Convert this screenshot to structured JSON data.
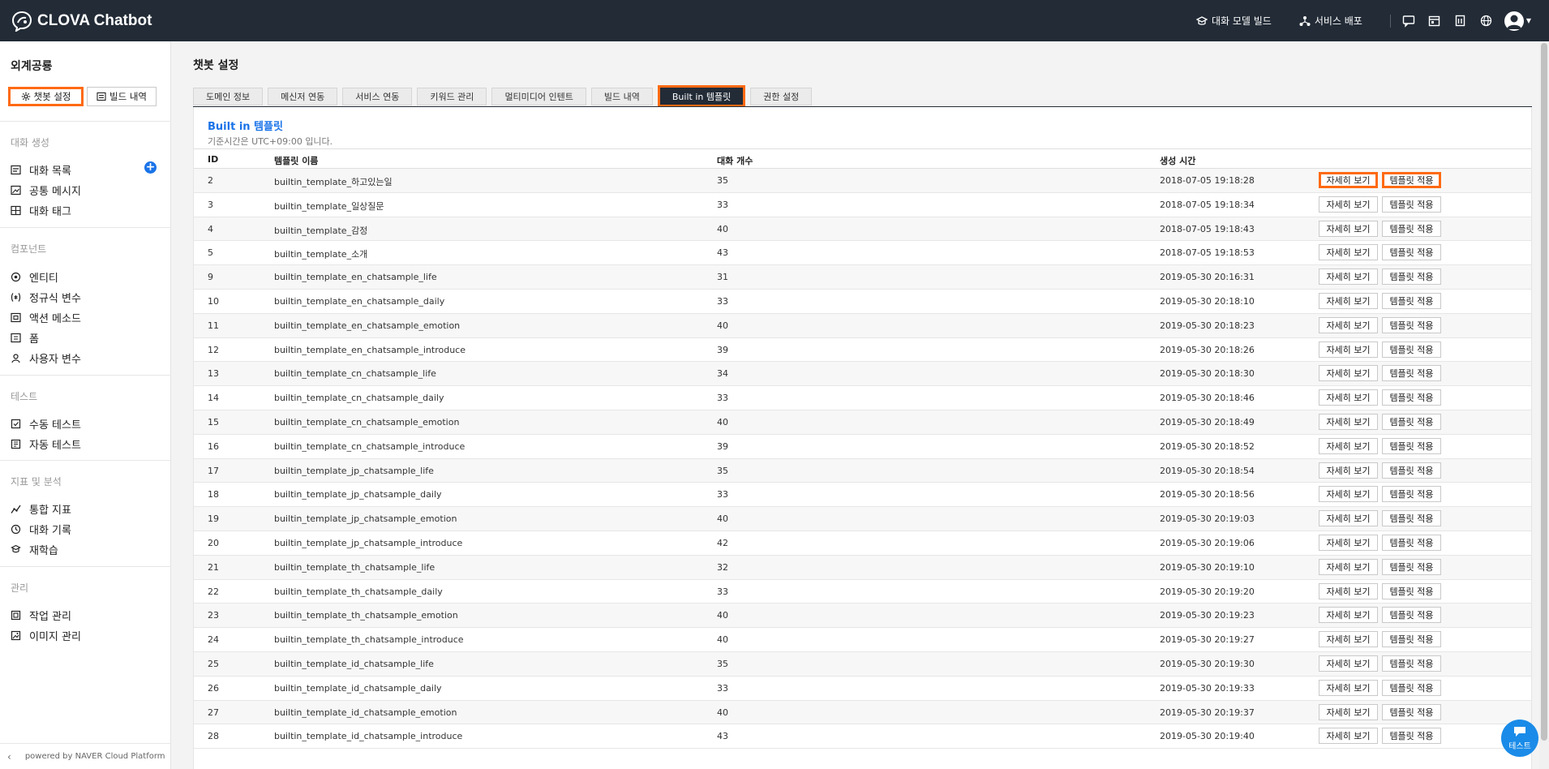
{
  "header": {
    "app_title": "CLOVA Chatbot",
    "links": [
      {
        "label": "대화 모델 빌드",
        "icon": "graduation-cap-icon"
      },
      {
        "label": "서비스 배포",
        "icon": "network-icon"
      }
    ],
    "icons": [
      "chat-icon",
      "calendar-icon",
      "document-icon",
      "globe-icon",
      "user-avatar-icon"
    ]
  },
  "sidebar": {
    "domain_name": "외계공룡",
    "buttons": [
      {
        "label": "챗봇 설정",
        "icon": "gear-icon"
      },
      {
        "label": "빌드 내역",
        "icon": "build-list-icon"
      }
    ],
    "sections": [
      {
        "title": "대화 생성",
        "items": [
          {
            "label": "대화 목록",
            "icon": "list-icon"
          },
          {
            "label": "공통 메시지",
            "icon": "image-message-icon"
          },
          {
            "label": "대화 태그",
            "icon": "tag-grid-icon"
          }
        ]
      },
      {
        "title": "컴포넌트",
        "items": [
          {
            "label": "엔티티",
            "icon": "target-icon"
          },
          {
            "label": "정규식 변수",
            "icon": "regex-icon"
          },
          {
            "label": "액션 메소드",
            "icon": "action-icon"
          },
          {
            "label": "폼",
            "icon": "form-icon"
          },
          {
            "label": "사용자 변수",
            "icon": "user-variable-icon"
          }
        ]
      },
      {
        "title": "테스트",
        "items": [
          {
            "label": "수동 테스트",
            "icon": "manual-test-icon"
          },
          {
            "label": "자동 테스트",
            "icon": "auto-test-icon"
          }
        ]
      },
      {
        "title": "지표 및 분석",
        "items": [
          {
            "label": "통합 지표",
            "icon": "chart-line-icon"
          },
          {
            "label": "대화 기록",
            "icon": "clock-icon"
          },
          {
            "label": "재학습",
            "icon": "relearn-icon"
          }
        ]
      },
      {
        "title": "관리",
        "items": [
          {
            "label": "작업 관리",
            "icon": "task-icon"
          },
          {
            "label": "이미지 관리",
            "icon": "image-manage-icon"
          }
        ]
      }
    ],
    "footer": "powered by NAVER Cloud Platform"
  },
  "main": {
    "page_title": "챗봇 설정",
    "tabs": [
      "도메인 정보",
      "메신저 연동",
      "서비스 연동",
      "키워드 관리",
      "멀티미디어 인텐트",
      "빌드 내역",
      "Built in 템플릿",
      "권한 설정"
    ],
    "active_tab": "Built in 템플릿",
    "panel": {
      "title": "Built in 템플릿",
      "subtitle": "기준시간은 UTC+09:00 입니다."
    },
    "table": {
      "columns": [
        "ID",
        "템플릿 이름",
        "대화 개수",
        "생성 시간"
      ],
      "detail_label": "자세히 보기",
      "apply_label": "템플릿 적용",
      "rows": [
        [
          "2",
          "builtin_template_하고있는일",
          "35",
          "2018-07-05 19:18:28"
        ],
        [
          "3",
          "builtin_template_일상질문",
          "33",
          "2018-07-05 19:18:34"
        ],
        [
          "4",
          "builtin_template_감정",
          "40",
          "2018-07-05 19:18:43"
        ],
        [
          "5",
          "builtin_template_소개",
          "43",
          "2018-07-05 19:18:53"
        ],
        [
          "9",
          "builtin_template_en_chatsample_life",
          "31",
          "2019-05-30 20:16:31"
        ],
        [
          "10",
          "builtin_template_en_chatsample_daily",
          "33",
          "2019-05-30 20:18:10"
        ],
        [
          "11",
          "builtin_template_en_chatsample_emotion",
          "40",
          "2019-05-30 20:18:23"
        ],
        [
          "12",
          "builtin_template_en_chatsample_introduce",
          "39",
          "2019-05-30 20:18:26"
        ],
        [
          "13",
          "builtin_template_cn_chatsample_life",
          "34",
          "2019-05-30 20:18:30"
        ],
        [
          "14",
          "builtin_template_cn_chatsample_daily",
          "33",
          "2019-05-30 20:18:46"
        ],
        [
          "15",
          "builtin_template_cn_chatsample_emotion",
          "40",
          "2019-05-30 20:18:49"
        ],
        [
          "16",
          "builtin_template_cn_chatsample_introduce",
          "39",
          "2019-05-30 20:18:52"
        ],
        [
          "17",
          "builtin_template_jp_chatsample_life",
          "35",
          "2019-05-30 20:18:54"
        ],
        [
          "18",
          "builtin_template_jp_chatsample_daily",
          "33",
          "2019-05-30 20:18:56"
        ],
        [
          "19",
          "builtin_template_jp_chatsample_emotion",
          "40",
          "2019-05-30 20:19:03"
        ],
        [
          "20",
          "builtin_template_jp_chatsample_introduce",
          "42",
          "2019-05-30 20:19:06"
        ],
        [
          "21",
          "builtin_template_th_chatsample_life",
          "32",
          "2019-05-30 20:19:10"
        ],
        [
          "22",
          "builtin_template_th_chatsample_daily",
          "33",
          "2019-05-30 20:19:20"
        ],
        [
          "23",
          "builtin_template_th_chatsample_emotion",
          "40",
          "2019-05-30 20:19:23"
        ],
        [
          "24",
          "builtin_template_th_chatsample_introduce",
          "40",
          "2019-05-30 20:19:27"
        ],
        [
          "25",
          "builtin_template_id_chatsample_life",
          "35",
          "2019-05-30 20:19:30"
        ],
        [
          "26",
          "builtin_template_id_chatsample_daily",
          "33",
          "2019-05-30 20:19:33"
        ],
        [
          "27",
          "builtin_template_id_chatsample_emotion",
          "40",
          "2019-05-30 20:19:37"
        ],
        [
          "28",
          "builtin_template_id_chatsample_introduce",
          "43",
          "2019-05-30 20:19:40"
        ]
      ]
    }
  },
  "test_fab_label": "테스트",
  "colors": {
    "header_bg": "#222b36",
    "highlight": "#ff6a13",
    "accent": "#1a73e8"
  }
}
